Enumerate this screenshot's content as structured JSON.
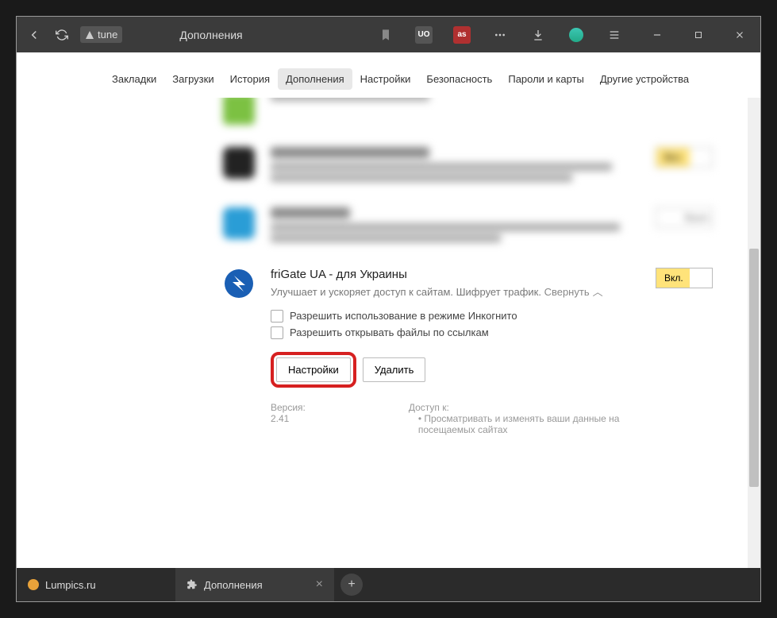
{
  "titlebar": {
    "url_badge_text": "tune",
    "page_title": "Дополнения"
  },
  "nav_tabs": [
    {
      "label": "Закладки",
      "active": false
    },
    {
      "label": "Загрузки",
      "active": false
    },
    {
      "label": "История",
      "active": false
    },
    {
      "label": "Дополнения",
      "active": true
    },
    {
      "label": "Настройки",
      "active": false
    },
    {
      "label": "Безопасность",
      "active": false
    },
    {
      "label": "Пароли и карты",
      "active": false
    },
    {
      "label": "Другие устройства",
      "active": false
    }
  ],
  "toggle": {
    "on_label": "Вкл.",
    "off_label": "Выкл."
  },
  "frigate": {
    "title": "friGate UA - для Украины",
    "desc_prefix": "Улучшает и ускоряет доступ к сайтам. Шифрует трафик.",
    "collapse": "Свернуть",
    "cb1": "Разрешить использование в режиме Инкогнито",
    "cb2": "Разрешить открывать файлы по ссылкам",
    "btn_settings": "Настройки",
    "btn_delete": "Удалить",
    "version": "Версия: 2.41",
    "access_label": "Доступ к:",
    "access_item": "Просматривать и изменять ваши данные на посещаемых сайтах"
  },
  "bottom_tabs": [
    {
      "label": "Lumpics.ru",
      "active": false,
      "icon": "lump"
    },
    {
      "label": "Дополнения",
      "active": true,
      "icon": "ext"
    }
  ]
}
